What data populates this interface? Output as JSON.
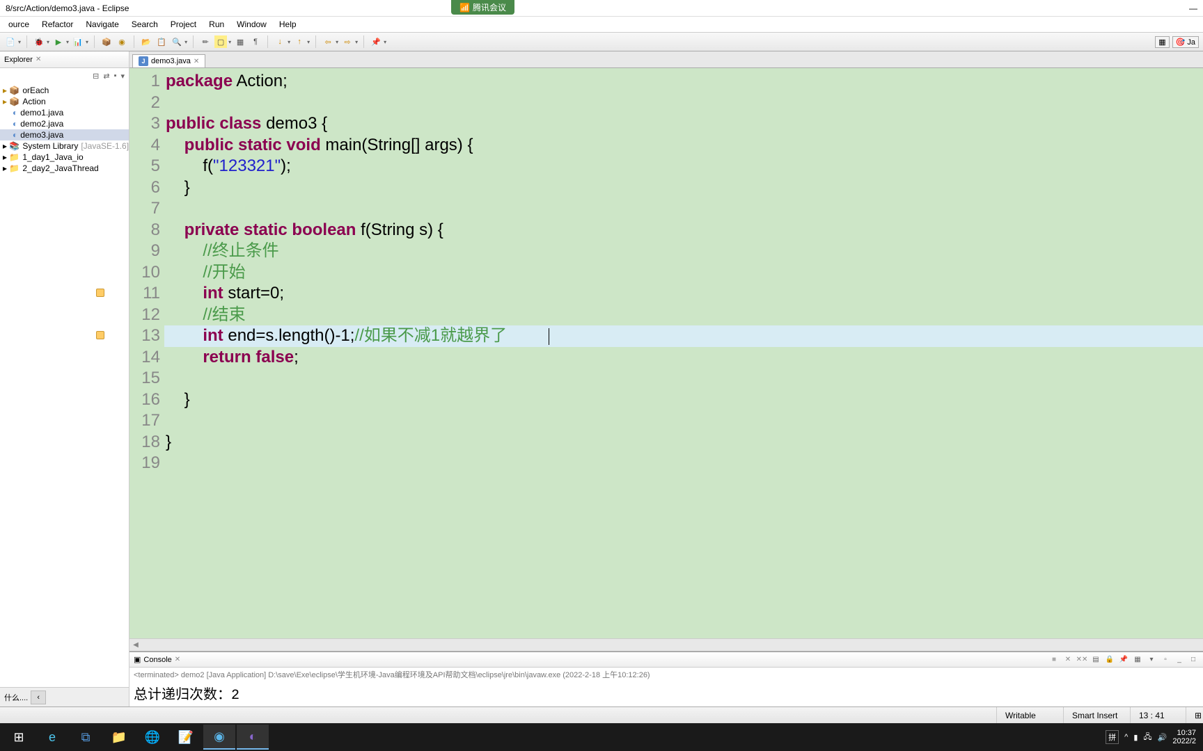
{
  "title": "8/src/Action/demo3.java - Eclipse",
  "tencent": "腾讯会议",
  "menu": [
    "ource",
    "Refactor",
    "Navigate",
    "Search",
    "Project",
    "Run",
    "Window",
    "Help"
  ],
  "sidebar": {
    "tab": "Explorer",
    "items": [
      {
        "label": "orEach",
        "indent": 0,
        "type": "pkg"
      },
      {
        "label": "Action",
        "indent": 0,
        "type": "pkg"
      },
      {
        "label": "demo1.java",
        "indent": 1,
        "type": "java"
      },
      {
        "label": "demo2.java",
        "indent": 1,
        "type": "java"
      },
      {
        "label": "demo3.java",
        "indent": 1,
        "type": "java",
        "sel": true
      },
      {
        "label": "System Library ",
        "extra": "[JavaSE-1.6]",
        "indent": 0,
        "type": "lib"
      },
      {
        "label": "1_day1_Java_io",
        "indent": 0,
        "type": "proj"
      },
      {
        "label": "2_day2_JavaThread",
        "indent": 0,
        "type": "proj"
      }
    ],
    "bottom": "什么...."
  },
  "editor": {
    "tab": "demo3.java",
    "lines": [
      {
        "n": 1,
        "html": "<span class='kw'>package</span> Action;"
      },
      {
        "n": 2,
        "html": ""
      },
      {
        "n": 3,
        "html": "<span class='kw'>public</span> <span class='kw'>class</span> demo3 {"
      },
      {
        "n": 4,
        "html": "    <span class='kw'>public</span> <span class='kw'>static</span> <span class='kw'>void</span> main(String[] args) {"
      },
      {
        "n": 5,
        "html": "        f(<span class='str'>\"123321\"</span>);"
      },
      {
        "n": 6,
        "html": "    }"
      },
      {
        "n": 7,
        "html": ""
      },
      {
        "n": 8,
        "html": "    <span class='kw'>private</span> <span class='kw'>static</span> <span class='kw'>boolean</span> f(String s) {"
      },
      {
        "n": 9,
        "html": "        <span class='cmt'>//终止条件</span>"
      },
      {
        "n": 10,
        "html": "        <span class='cmt'>//开始</span>"
      },
      {
        "n": 11,
        "html": "        <span class='kw'>int</span> start=0;",
        "marker": true
      },
      {
        "n": 12,
        "html": "        <span class='cmt'>//结束</span>"
      },
      {
        "n": 13,
        "html": "        <span class='kw'>int</span> end=s.length()-1;<span class='cmt'>//如果不减1就越界了</span>",
        "marker": true,
        "hl": true,
        "cursor": true
      },
      {
        "n": 14,
        "html": "        <span class='kw'>return</span> <span class='kw'>false</span>;"
      },
      {
        "n": 15,
        "html": ""
      },
      {
        "n": 16,
        "html": "    }"
      },
      {
        "n": 17,
        "html": ""
      },
      {
        "n": 18,
        "html": "}"
      },
      {
        "n": 19,
        "html": ""
      }
    ]
  },
  "console": {
    "tab": "Console",
    "info": "<terminated> demo2 [Java Application] D:\\save\\Exe\\eclipse\\学生机环境-Java编程环境及API帮助文档\\eclipse\\jre\\bin\\javaw.exe (2022-2-18 上午10:12:26)",
    "output": "总计递归次数：2"
  },
  "status": {
    "writable": "Writable",
    "insert": "Smart Insert",
    "pos": "13 : 41"
  },
  "tray": {
    "ime": "拼",
    "time": "10:37",
    "date": "2022/2"
  }
}
